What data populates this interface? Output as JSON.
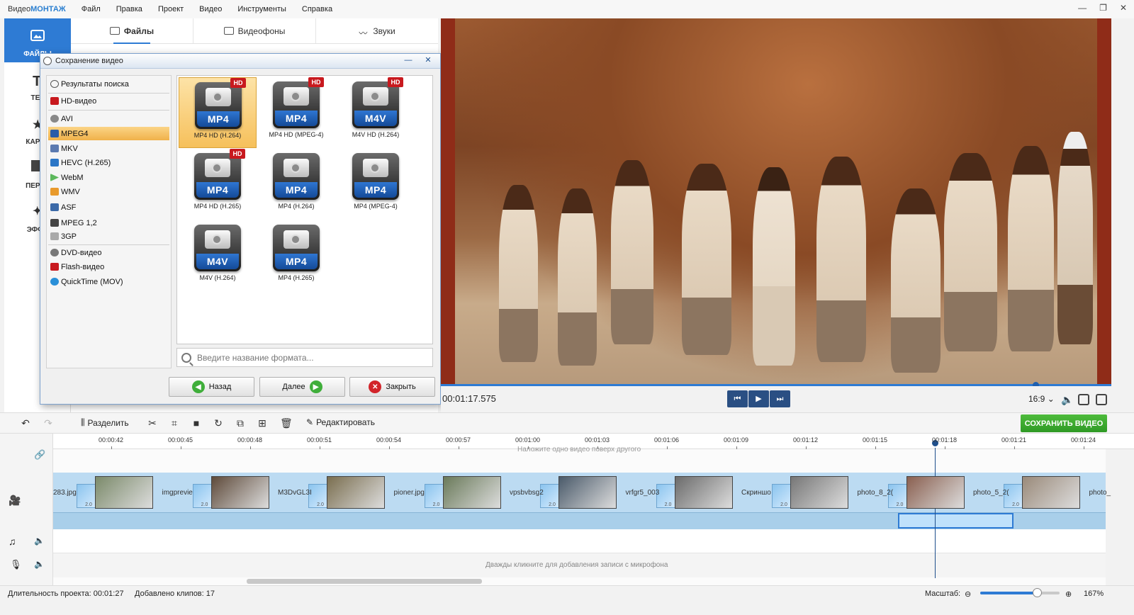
{
  "menubar": {
    "brand_prefix": "Видео",
    "brand_suffix": "МОНТАЖ",
    "items": [
      "Файл",
      "Правка",
      "Проект",
      "Видео",
      "Инструменты",
      "Справка"
    ]
  },
  "leftnav": {
    "items": [
      {
        "label": "ФАЙЛЫ"
      },
      {
        "label": "ТЕК"
      },
      {
        "label": "КАРТИ"
      },
      {
        "label": "ПЕРЕХ"
      },
      {
        "label": "ЭФФЕ"
      }
    ]
  },
  "library": {
    "tabs": [
      "Файлы",
      "Видеофоны",
      "Звуки"
    ],
    "active_tab": "Файлы"
  },
  "dialog": {
    "title": "Сохранение видео",
    "formats": [
      {
        "label": "Результаты поиска",
        "icon": "search-icon"
      },
      {
        "label": "HD-видео",
        "icon": "hd-icon"
      },
      {
        "label": "AVI",
        "icon": "avi-icon"
      },
      {
        "label": "MPEG4",
        "icon": "mpeg4-icon",
        "selected": true
      },
      {
        "label": "MKV",
        "icon": "mkv-icon"
      },
      {
        "label": "HEVC (H.265)",
        "icon": "hevc-icon"
      },
      {
        "label": "WebM",
        "icon": "webm-icon"
      },
      {
        "label": "WMV",
        "icon": "wmv-icon"
      },
      {
        "label": "ASF",
        "icon": "asf-icon"
      },
      {
        "label": "MPEG 1,2",
        "icon": "mpeg12-icon"
      },
      {
        "label": "3GP",
        "icon": "3gp-icon"
      },
      {
        "label": "DVD-видео",
        "icon": "dvd-icon"
      },
      {
        "label": "Flash-видео",
        "icon": "flash-icon"
      },
      {
        "label": "QuickTime (MOV)",
        "icon": "quicktime-icon"
      }
    ],
    "tiles": [
      {
        "tag": "MP4",
        "hd": "HD",
        "caption": "MP4 HD (H.264)",
        "selected": true
      },
      {
        "tag": "MP4",
        "hd": "HD",
        "caption": "MP4 HD (MPEG-4)"
      },
      {
        "tag": "M4V",
        "hd": "HD",
        "caption": "M4V HD (H.264)"
      },
      {
        "tag": "MP4",
        "hd": "HD",
        "caption": "MP4 HD (H.265)"
      },
      {
        "tag": "MP4",
        "hd": "",
        "caption": "MP4 (H.264)"
      },
      {
        "tag": "MP4",
        "hd": "",
        "caption": "MP4 (MPEG-4)"
      },
      {
        "tag": "M4V",
        "hd": "",
        "caption": "M4V (H.264)"
      },
      {
        "tag": "MP4",
        "hd": "",
        "caption": "MP4 (H.265)"
      }
    ],
    "search_placeholder": "Введите название формата...",
    "buttons": {
      "back": "Назад",
      "next": "Далее",
      "close": "Закрыть"
    }
  },
  "preview": {
    "timecode": "00:01:17.575",
    "aspect": "16:9",
    "progress": 0.886
  },
  "toolbar": {
    "split_label": "Разделить",
    "edit_label": "Редактировать",
    "save_label": "СОХРАНИТЬ ВИДЕО"
  },
  "timeline": {
    "ticks": [
      "00:00:42",
      "00:00:45",
      "00:00:48",
      "00:00:51",
      "00:00:54",
      "00:00:57",
      "00:01:00",
      "00:01:03",
      "00:01:06",
      "00:01:09",
      "00:01:12",
      "00:01:15",
      "00:01:18",
      "00:01:21",
      "00:01:24"
    ],
    "overlay_hint": "Наложите одно видео поверх другого",
    "mic_hint": "Дважды кликните для добавления записи с микрофона",
    "clips": [
      {
        "name": "283.jpg",
        "transition": "2.0"
      },
      {
        "name": "imgprevie",
        "transition": "2.0"
      },
      {
        "name": "M3DvGL3I",
        "transition": "2.0"
      },
      {
        "name": "pioner.jpg",
        "transition": "2.0"
      },
      {
        "name": "vpsbvbsg2",
        "transition": "2.0"
      },
      {
        "name": "vrfgr5_003",
        "transition": "2.0"
      },
      {
        "name": "Скриншо",
        "transition": "2.0"
      },
      {
        "name": "photo_8_2(",
        "transition": "2.0"
      },
      {
        "name": "photo_5_2(",
        "transition": "2.0"
      },
      {
        "name": "photo_",
        "transition": ""
      }
    ]
  },
  "status": {
    "duration": "Длительность проекта: 00:01:27",
    "clips_added": "Добавлено клипов: 17",
    "zoom_label": "Масштаб:",
    "zoom_value": "167%"
  }
}
